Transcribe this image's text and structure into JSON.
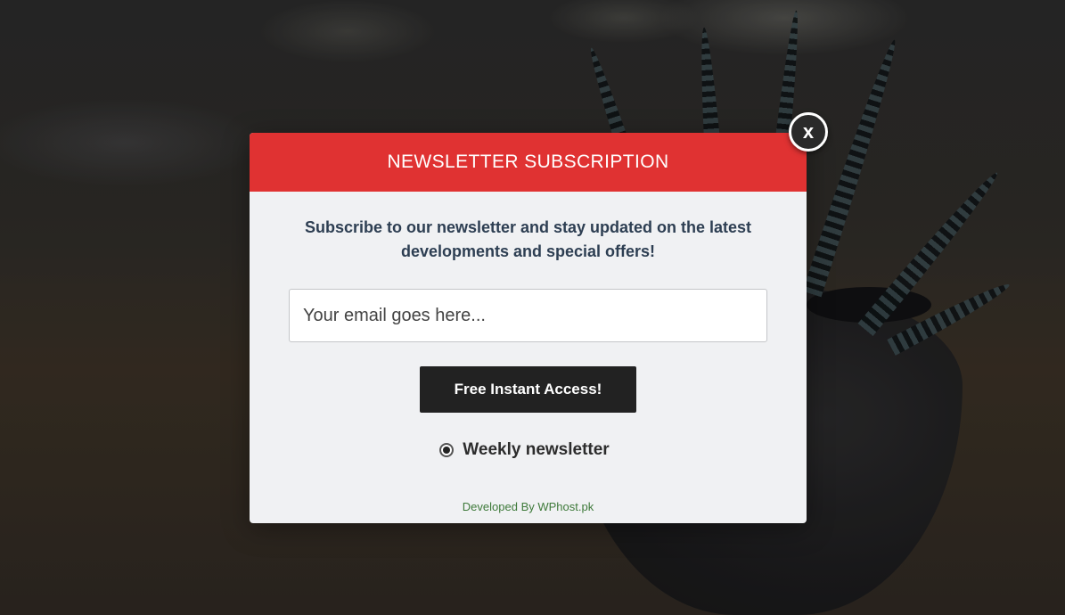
{
  "modal": {
    "title": "NEWSLETTER SUBSCRIPTION",
    "intro": "Subscribe to our newsletter and stay updated on the latest developments and special offers!",
    "email_placeholder": "Your email goes here...",
    "email_value": "",
    "submit_label": "Free Instant Access!",
    "option_label": "Weekly newsletter",
    "option_selected": true,
    "footer_credit": "Developed By WPhost.pk",
    "close_label": "x"
  },
  "colors": {
    "header_bg": "#e03232",
    "body_bg": "#f0f1f3",
    "button_bg": "#222222",
    "intro_text": "#2d3e52",
    "credit_text": "#3e7a3a"
  },
  "icons": {
    "close": "close-icon",
    "radio": "radio-selected-icon"
  }
}
